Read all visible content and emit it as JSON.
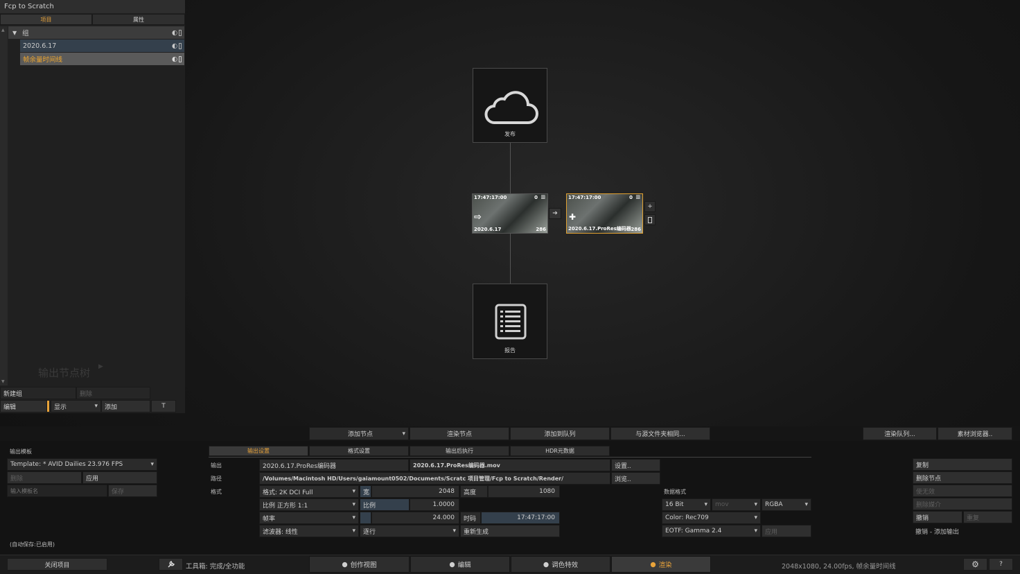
{
  "window": {
    "title": "Fcp to Scratch"
  },
  "tree_tabs": [
    {
      "label": "项目",
      "active": true
    },
    {
      "label": "属性",
      "active": false
    }
  ],
  "tree": {
    "rows": [
      {
        "label": "组",
        "expanded": true
      },
      {
        "label": "2020.6.17"
      },
      {
        "label": "帧余量时间线",
        "highlight": true
      }
    ],
    "watermark": "输出节点树",
    "new_group": "新建组",
    "delete": "删除",
    "edit": "编辑",
    "show": "显示",
    "add": "添加",
    "t": "T"
  },
  "graph": {
    "publish_label": "发布",
    "report_label": "报告",
    "source_node": {
      "timecode": "17:47:17:00",
      "index": "0",
      "name": "2020.6.17",
      "count": "286"
    },
    "output_node": {
      "timecode": "17:47:17:00",
      "index": "0",
      "name": "2020.6.17.ProRes编码器",
      "count": "286"
    },
    "plus": "+"
  },
  "toolbar": {
    "add_node": "添加节点",
    "render_node": "渲染节点",
    "add_to_queue": "添加到队列",
    "same_as_source": "与源文件夹相同...",
    "render_queue": "渲染队列...",
    "media_browser": "素材浏览器.."
  },
  "template": {
    "section": "输出模板",
    "value": "Template: * AVID Dailies 23.976 FPS",
    "delete": "删除",
    "apply": "应用",
    "name_placeholder": "输入模板名",
    "save": "保存",
    "autosave": "(自动保存:已启用)"
  },
  "tabs": [
    {
      "label": "输出设置",
      "active": true
    },
    {
      "label": "格式设置",
      "active": false
    },
    {
      "label": "输出后执行",
      "active": false
    },
    {
      "label": "HDR元数据",
      "active": false
    }
  ],
  "settings": {
    "output_label": "输出",
    "output_name": "2020.6.17.ProRes编码器",
    "output_file": "2020.6.17.ProRes编码器.mov",
    "setup": "设置..",
    "path_label": "路径",
    "path": "/Volumes/Macintosh HD/Users/gaiamount0502/Documents/Scratc 项目管理/Fcp to Scratch/Render/",
    "browse": "浏览..",
    "format_label": "格式",
    "format": "格式: 2K DCI Full",
    "width_label": "宽",
    "width": "2048",
    "height_label": "高度",
    "height": "1080",
    "aspect": "比例 正方形 1:1",
    "ratio_label": "比例",
    "ratio": "1.0000",
    "framerate": "帧率",
    "fps": "24.000",
    "tc_label": "时码",
    "timecode": "17:47:17:00",
    "filter": "滤波器: 线性",
    "scan": "逐行",
    "regenerate": "重新生成",
    "data_format_label": "数据格式",
    "bitdepth": "16 Bit",
    "container": "mov",
    "channels": "RGBA",
    "color": "Color: Rec709",
    "eotf": "EOTF: Gamma 2.4",
    "apply": "应用"
  },
  "actions": {
    "copy": "复制",
    "delete_node": "删除节点",
    "invalidate": "使无效",
    "delete_media": "删除媒介",
    "undo": "撤销",
    "redo": "重复",
    "undo_desc": "撤销 - 添加输出"
  },
  "statusbar": {
    "close_project": "关闭项目",
    "toolbox": "工具箱: 完成/全功能",
    "modes": [
      {
        "label": "创作视图",
        "active": false
      },
      {
        "label": "编辑",
        "active": false
      },
      {
        "label": "调色特效",
        "active": false
      },
      {
        "label": "渲染",
        "active": true
      }
    ],
    "info": "2048x1080, 24.00fps, 帧余量时间线",
    "help": "?"
  },
  "colors": {
    "accent": "#e8a33a",
    "selection": "#3a4550"
  }
}
